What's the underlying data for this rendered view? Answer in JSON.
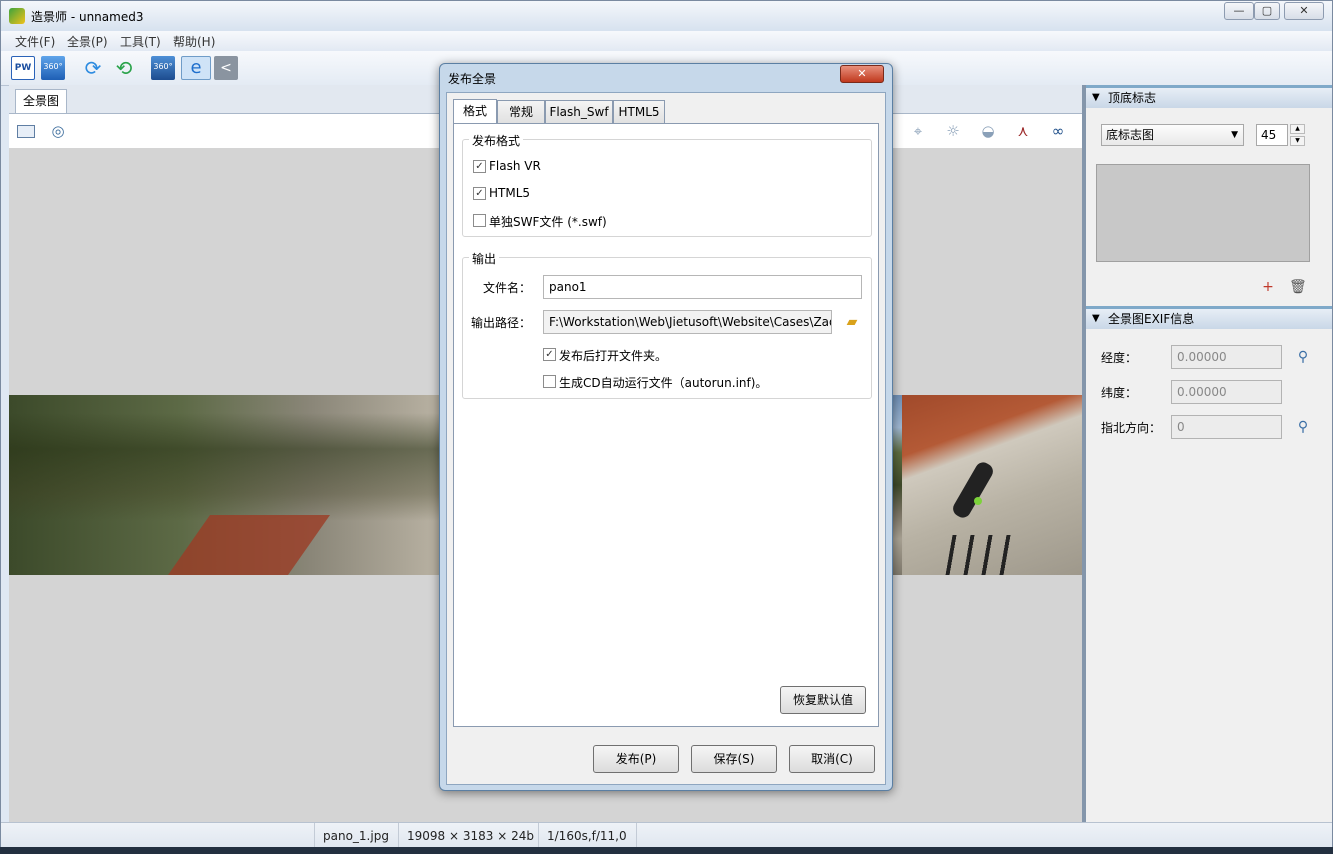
{
  "window": {
    "title": "造景师 - unnamed3",
    "min_label": "—",
    "max_label": "▢",
    "close_label": "✕"
  },
  "menu": {
    "file": "文件(F)",
    "panorama": "全景(P)",
    "tools": "工具(T)",
    "help": "帮助(H)"
  },
  "toolbar": {
    "pw_label": "PW",
    "icon_360_label": "360°"
  },
  "doc_tab": {
    "label": "全景图"
  },
  "right_panel": {
    "logo_section": {
      "title": "顶底标志",
      "combo_value": "底标志图",
      "size_value": "45"
    },
    "exif_section": {
      "title": "全景图EXIF信息",
      "longitude_label": "经度：",
      "longitude_value": "0.00000",
      "latitude_label": "纬度：",
      "latitude_value": "0.00000",
      "north_label": "指北方向：",
      "north_value": "0"
    }
  },
  "status": {
    "filename": "pano_1.jpg",
    "size": "19098 × 3183 × 24b",
    "exposure": "1/160s,f/11,0"
  },
  "dialog": {
    "title": "发布全景",
    "tabs": [
      "格式",
      "常规",
      "Flash_Swf",
      "HTML5"
    ],
    "format_group": {
      "title": "发布格式",
      "options": [
        {
          "label": "Flash VR",
          "checked": "✓"
        },
        {
          "label": "HTML5",
          "checked": "✓"
        },
        {
          "label": "单独SWF文件 (*.swf)",
          "checked": ""
        }
      ]
    },
    "output_group": {
      "title": "输出",
      "filename_label": "文件名：",
      "filename_value": "pano1",
      "path_label": "输出路径：",
      "path_value": "F:\\Workstation\\Web\\Jietusoft\\Website\\Cases\\Zao",
      "open_folder_label": "发布后打开文件夹。",
      "open_folder_checked": "✓",
      "autorun_label": "生成CD自动运行文件（autorun.inf)。",
      "autorun_checked": ""
    },
    "restore_button": "恢复默认值",
    "publish_button": "发布(P)",
    "save_button": "保存(S)",
    "cancel_button": "取消(C)"
  }
}
